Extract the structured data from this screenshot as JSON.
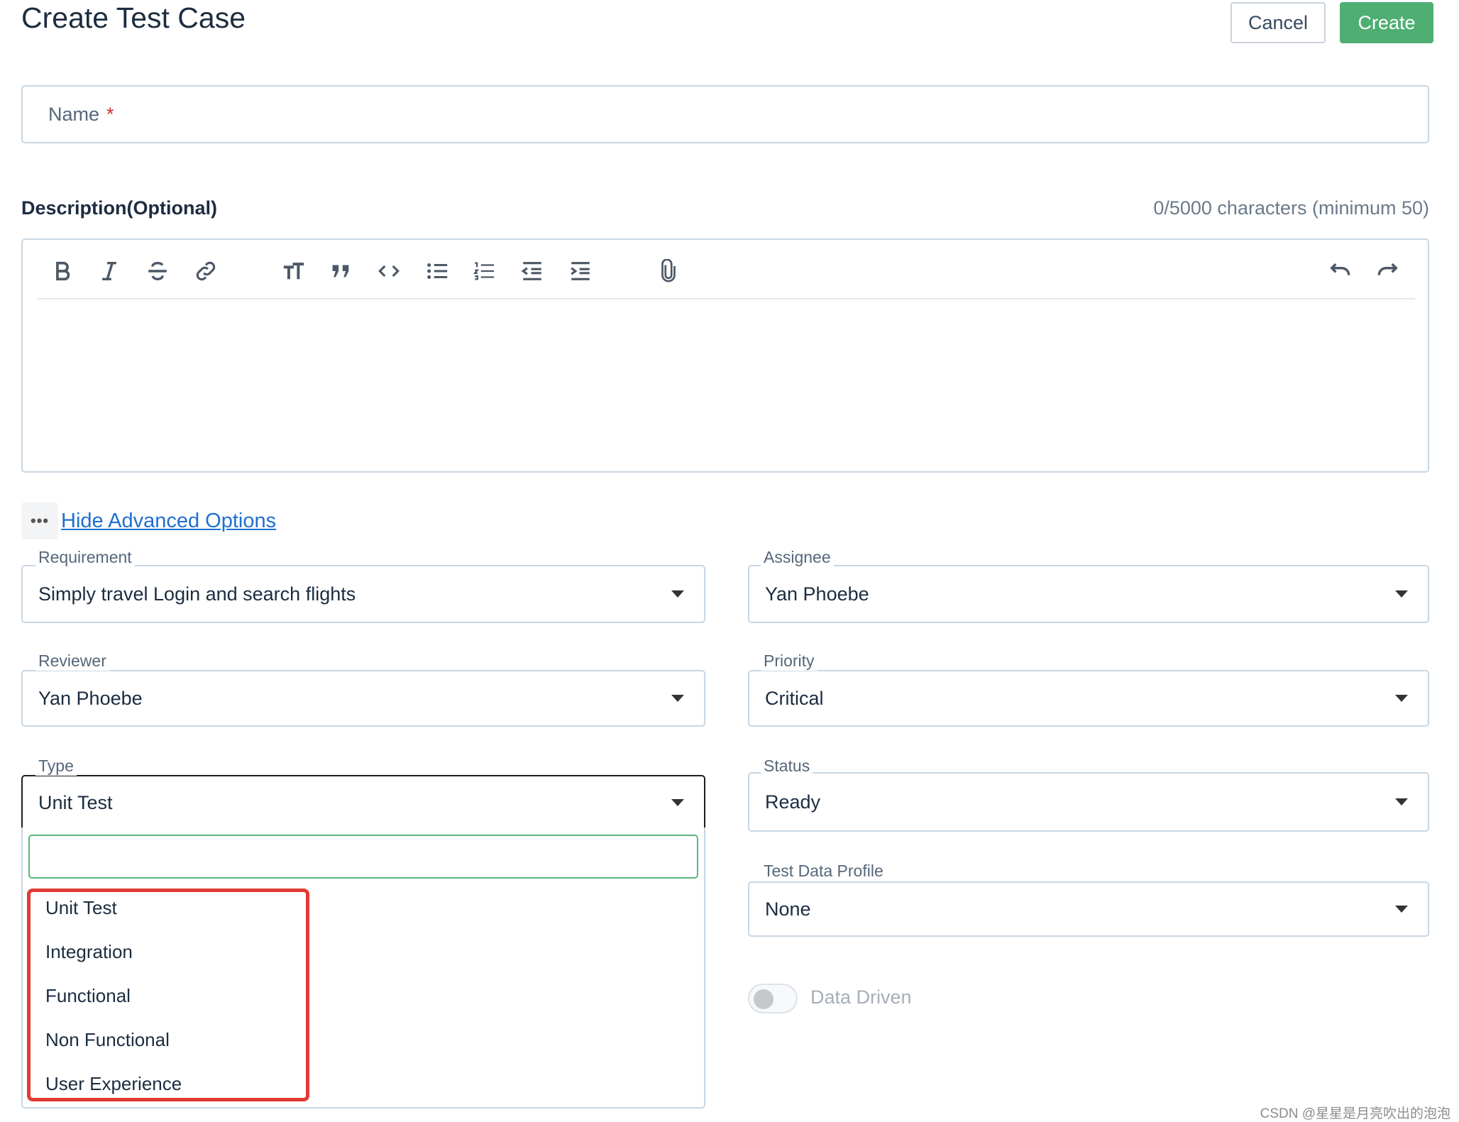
{
  "header": {
    "title": "Create Test Case",
    "cancel_label": "Cancel",
    "create_label": "Create"
  },
  "name_field": {
    "label": "Name",
    "required_mark": "*"
  },
  "description": {
    "label": "Description(Optional)",
    "counter": "0/5000 characters (minimum 50)",
    "toolbar_icons": [
      "bold-icon",
      "italic-icon",
      "strikethrough-icon",
      "link-icon",
      "text-size-icon",
      "quote-icon",
      "code-icon",
      "bullet-list-icon",
      "numbered-list-icon",
      "outdent-icon",
      "indent-icon",
      "attachment-icon",
      "undo-icon",
      "redo-icon"
    ]
  },
  "advanced": {
    "dots": "•••",
    "link_label": "Hide Advanced Options"
  },
  "fields": {
    "requirement": {
      "label": "Requirement",
      "value": "Simply travel Login and search flights"
    },
    "assignee": {
      "label": "Assignee",
      "value": "Yan Phoebe"
    },
    "reviewer": {
      "label": "Reviewer",
      "value": "Yan Phoebe"
    },
    "priority": {
      "label": "Priority",
      "value": "Critical"
    },
    "type": {
      "label": "Type",
      "value": "Unit Test"
    },
    "status": {
      "label": "Status",
      "value": "Ready"
    },
    "test_data_profile": {
      "label": "Test Data Profile",
      "value": "None"
    }
  },
  "type_dropdown": {
    "search_value": "",
    "options": [
      "Unit Test",
      "Integration",
      "Functional",
      "Non Functional",
      "User Experience"
    ]
  },
  "data_driven": {
    "label": "Data Driven",
    "enabled": false
  },
  "colors": {
    "primary": "#4fae72",
    "link": "#1f6fd1",
    "highlight": "#e13b33",
    "required": "#d0342c"
  },
  "watermark": "CSDN @星星是月亮吹出的泡泡"
}
